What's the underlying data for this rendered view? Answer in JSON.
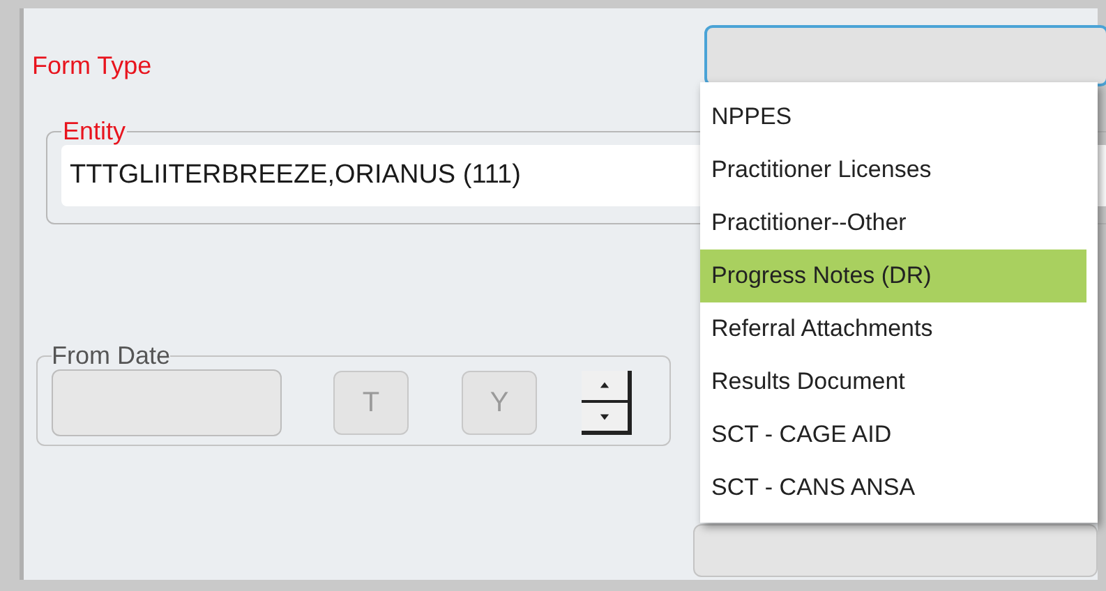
{
  "form_type": {
    "label": "Form Type",
    "options": [
      {
        "label": "NPPES",
        "selected": false
      },
      {
        "label": "Practitioner Licenses",
        "selected": false
      },
      {
        "label": "Practitioner--Other",
        "selected": false
      },
      {
        "label": "Progress Notes (DR)",
        "selected": true
      },
      {
        "label": "Referral Attachments",
        "selected": false
      },
      {
        "label": "Results Document",
        "selected": false
      },
      {
        "label": "SCT - CAGE AID",
        "selected": false
      },
      {
        "label": "SCT - CANS ANSA",
        "selected": false
      }
    ]
  },
  "entity": {
    "legend": "Entity",
    "value": "TTTGLIITERBREEZE,ORIANUS (111)"
  },
  "from_date": {
    "legend": "From Date",
    "buttons": [
      "T",
      "Y"
    ]
  }
}
